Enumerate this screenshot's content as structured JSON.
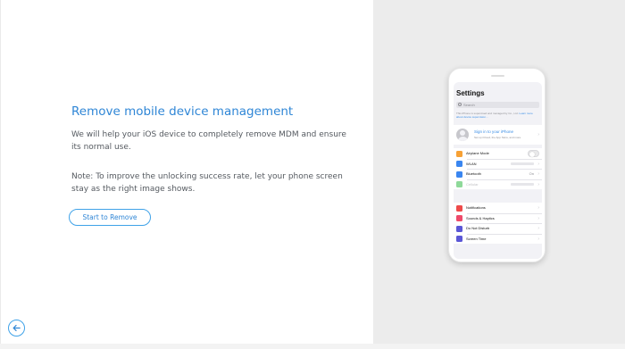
{
  "main": {
    "title": "Remove mobile device management",
    "description": "We will help your iOS device to completely remove MDM and ensure its normal use.",
    "note": "Note: To improve the unlocking success rate, let your phone screen stay as the right image shows.",
    "start_button_label": "Start to Remove"
  },
  "colors": {
    "accent": "#2f86d6",
    "button_border": "#3fa2e8",
    "right_pane_bg": "#ececec"
  },
  "phone": {
    "settings_title": "Settings",
    "search_placeholder": "Search",
    "notice_text": "This iPhone is supervised and managed by",
    "notice_text_2": "Co., Ltd.",
    "notice_link": "Learn more about device supervision...",
    "sign_in_title": "Sign in to your iPhone",
    "sign_in_subtitle": "Set up iCloud, the App Store, and more.",
    "group1": [
      {
        "label": "Airplane Mode",
        "icon": "airplane-icon",
        "color": "#f7a135",
        "control": "toggle"
      },
      {
        "label": "WLAN",
        "icon": "wifi-icon",
        "color": "#3a86f0",
        "control": "blurred"
      },
      {
        "label": "Bluetooth",
        "icon": "bluetooth-icon",
        "color": "#3a86f0",
        "value": "On"
      },
      {
        "label": "Cellular",
        "icon": "cellular-icon",
        "color": "#8fd99a",
        "control": "blurred",
        "disabled": true
      }
    ],
    "group2": [
      {
        "label": "Notifications",
        "icon": "notifications-icon",
        "color": "#ee4a4a"
      },
      {
        "label": "Sounds & Haptics",
        "icon": "sounds-icon",
        "color": "#ee4a6a"
      },
      {
        "label": "Do Not Disturb",
        "icon": "moon-icon",
        "color": "#5b57d6"
      },
      {
        "label": "Screen Time",
        "icon": "hourglass-icon",
        "color": "#5b57d6"
      }
    ]
  }
}
